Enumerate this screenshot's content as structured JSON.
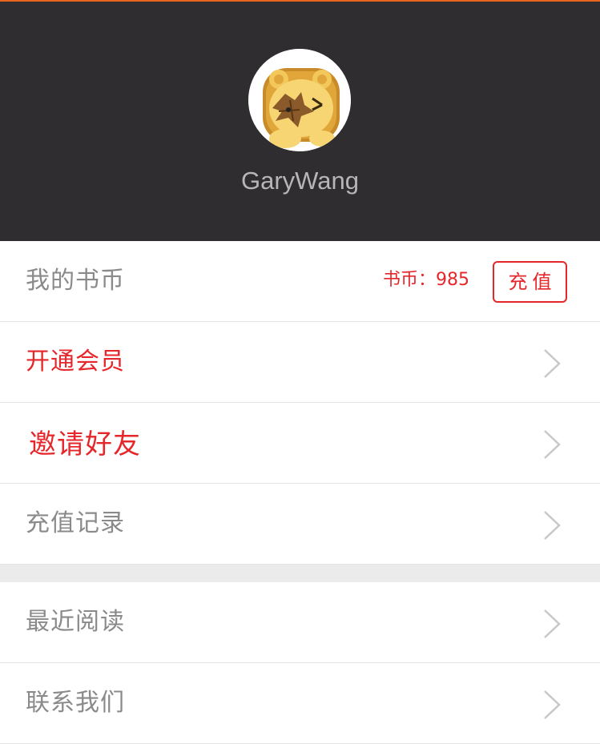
{
  "profile": {
    "username": "GaryWang",
    "avatar_icon": "lion-avatar-icon"
  },
  "coins": {
    "label": "我的书币",
    "balance_text": "书币：985",
    "recharge_label": "充值"
  },
  "menu": {
    "vip_label": "开通会员",
    "invite_label": "邀请好友",
    "history_label": "充值记录",
    "recent_label": "最近阅读",
    "contact_label": "联系我们"
  },
  "colors": {
    "header_bg": "#2f2d2f",
    "accent_red": "#e5272c",
    "top_border": "#e8641e"
  }
}
